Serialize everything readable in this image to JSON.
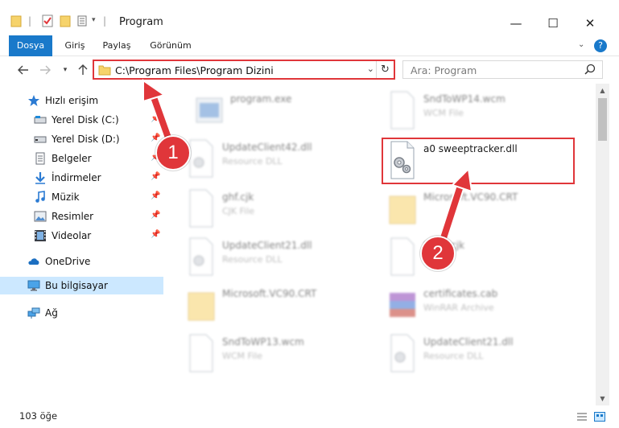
{
  "window": {
    "title": "Program",
    "controls": {
      "minimize": "—",
      "maximize": "☐",
      "close": "✕"
    }
  },
  "ribbon": {
    "tabs": [
      "Dosya",
      "Giriş",
      "Paylaş",
      "Görünüm"
    ],
    "help": "?"
  },
  "address_bar": {
    "path": "C:\\Program Files\\Program Dizini",
    "dropdown": "⌄",
    "refresh": "↻"
  },
  "search": {
    "placeholder": "Ara: Program"
  },
  "sidebar": {
    "quick_access": "Hızlı erişim",
    "items": [
      {
        "label": "Yerel Disk (C:)",
        "icon": "drive-icon",
        "pinned": true
      },
      {
        "label": "Yerel Disk (D:)",
        "icon": "drive-icon",
        "pinned": true
      },
      {
        "label": "Belgeler",
        "icon": "documents-icon",
        "pinned": true
      },
      {
        "label": "İndirmeler",
        "icon": "download-icon",
        "pinned": true
      },
      {
        "label": "Müzik",
        "icon": "music-icon",
        "pinned": true
      },
      {
        "label": "Resimler",
        "icon": "pictures-icon",
        "pinned": true
      },
      {
        "label": "Videolar",
        "icon": "videos-icon",
        "pinned": true
      }
    ],
    "onedrive": "OneDrive",
    "this_pc": "Bu bilgisayar",
    "network": "Ağ"
  },
  "files": [
    {
      "name": "program.exe",
      "type": ""
    },
    {
      "name": "SndToWP14.wcm",
      "type": "WCM File"
    },
    {
      "name": "UpdateClient42.dll",
      "type": "Resource DLL"
    },
    {
      "name": "a0 sweeptracker.dll",
      "type": ""
    },
    {
      "name": "ghf.cjk",
      "type": "CJK File"
    },
    {
      "name": "Microsoft.VC90.CRT",
      "type": ""
    },
    {
      "name": "UpdateClient21.dll",
      "type": "Resource DLL"
    },
    {
      "name": "Sndfl.cjk",
      "type": "CJK File"
    },
    {
      "name": "Microsoft.VC90.CRT",
      "type": ""
    },
    {
      "name": "certificates.cab",
      "type": "WinRAR Archive"
    },
    {
      "name": "SndToWP13.wcm",
      "type": "WCM File"
    },
    {
      "name": "UpdateClient21.dll",
      "type": "Resource DLL"
    }
  ],
  "annotations": [
    {
      "number": "1"
    },
    {
      "number": "2"
    }
  ],
  "status": {
    "count": "103 öğe"
  },
  "colors": {
    "accent": "#1979ca",
    "annotation": "#e0363a",
    "selected": "#cce8ff"
  }
}
